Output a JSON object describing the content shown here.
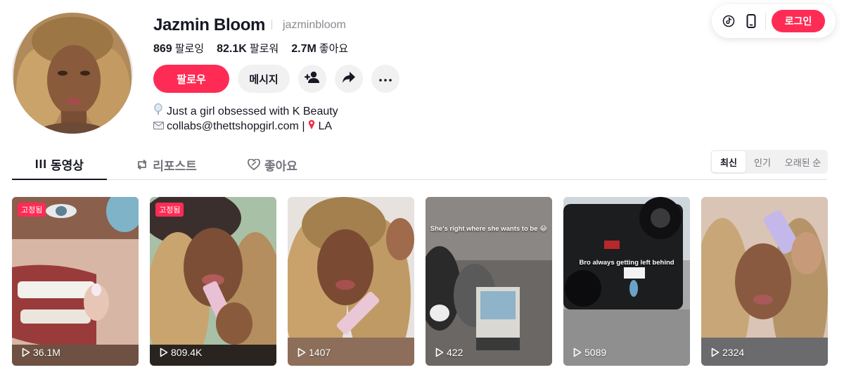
{
  "topbar": {
    "login_label": "로그인",
    "icons": [
      "tiktok-icon",
      "mobile-icon"
    ]
  },
  "profile": {
    "name": "Jazmin Bloom",
    "handle": "jazminbloom",
    "stats": [
      {
        "value": "869",
        "label": "팔로잉"
      },
      {
        "value": "82.1K",
        "label": "팔로워"
      },
      {
        "value": "2.7M",
        "label": "좋아요"
      }
    ],
    "follow_label": "팔로우",
    "message_label": "메시지",
    "bio_line1": "Just a girl obsessed with K Beauty",
    "bio_line2_a": "collabs@thettshopgirl.com |",
    "bio_line2_b": "LA"
  },
  "tabs": [
    {
      "label": "동영상",
      "icon": "grid-icon",
      "active": true
    },
    {
      "label": "리포스트",
      "icon": "repost-icon",
      "active": false
    },
    {
      "label": "좋아요",
      "icon": "heart-icon",
      "active": false
    }
  ],
  "sort": {
    "options": [
      "최신",
      "인기",
      "오래된 순"
    ],
    "selected": "최신"
  },
  "videos": [
    {
      "views": "36.1M",
      "pinned": "고정됨",
      "caption": ""
    },
    {
      "views": "809.4K",
      "pinned": "고정됨",
      "caption": ""
    },
    {
      "views": "1407",
      "pinned": "",
      "caption": ""
    },
    {
      "views": "422",
      "pinned": "",
      "caption": "She's right where she wants to be 😂"
    },
    {
      "views": "5089",
      "pinned": "",
      "caption": "Bro always getting left behind"
    },
    {
      "views": "2324",
      "pinned": "",
      "caption": ""
    }
  ],
  "colors": {
    "accent": "#fe2c55",
    "text": "#161823",
    "muted": "#73747b",
    "button_bg": "#f1f1f2"
  }
}
